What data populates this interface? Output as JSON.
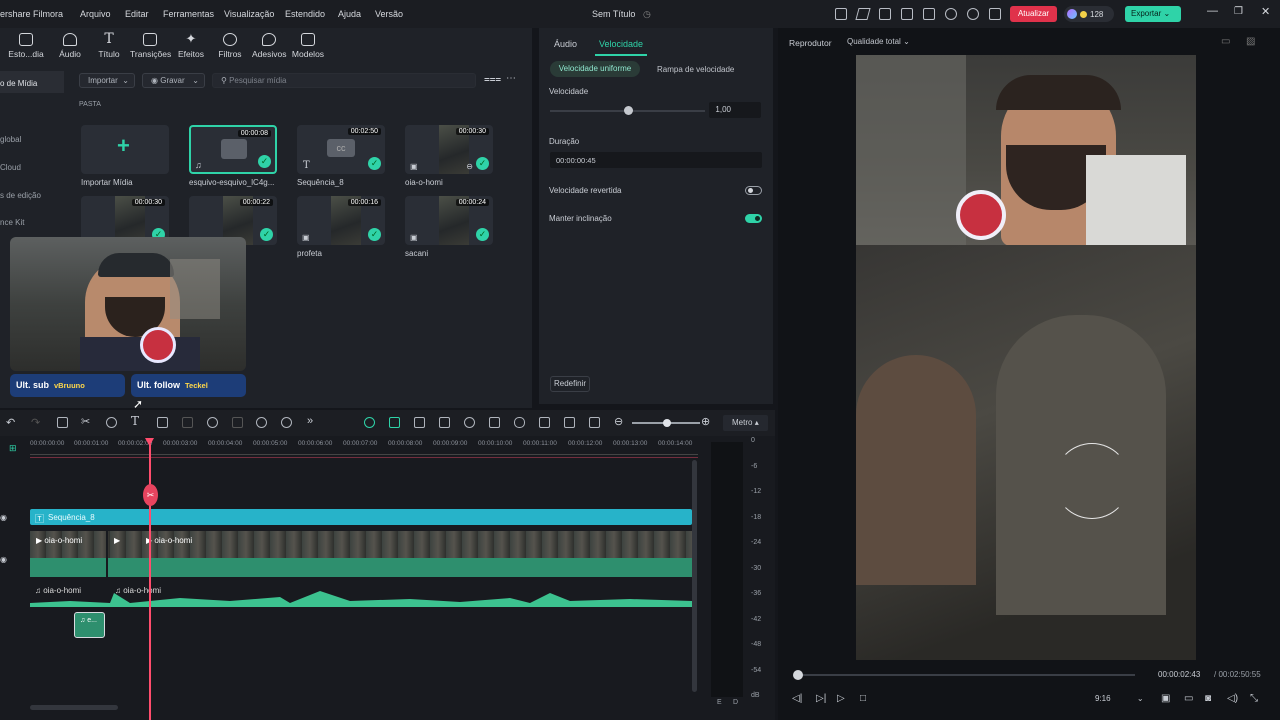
{
  "app": {
    "title_fragment": "ershare Filmora",
    "doc_title": "Sem Título"
  },
  "menu": [
    "Arquivo",
    "Editar",
    "Ferramentas",
    "Visualização",
    "Estendido",
    "Ajuda",
    "Versão"
  ],
  "top_buttons": {
    "update": "Atualizar",
    "credits": "128",
    "export": "Exportar"
  },
  "toolbar": [
    "Esto...dia",
    "Áudio",
    "Título",
    "Transições",
    "Efeitos",
    "Filtros",
    "Adesivos",
    "Modelos"
  ],
  "sidebar": [
    "o de Mídia",
    "global",
    "Cloud",
    "s de edição",
    "nce Kit"
  ],
  "media_bar": {
    "import": "Importar",
    "record": "Gravar",
    "search_placeholder": "Pesquisar mídia",
    "folder": "PASTA"
  },
  "media": [
    {
      "label": "Importar Mídia",
      "duration": ""
    },
    {
      "label": "esquivo-esquivo_lC4g...",
      "duration": "00:00:08"
    },
    {
      "label": "Sequência_8",
      "duration": "00:02:50"
    },
    {
      "label": "oia-o-homi",
      "duration": "00:00:30"
    },
    {
      "label": "",
      "duration": "00:00:30"
    },
    {
      "label": "",
      "duration": "00:00:22"
    },
    {
      "label": "profeta",
      "duration": "00:00:16"
    },
    {
      "label": "sacani",
      "duration": "00:00:24"
    }
  ],
  "overlay": {
    "sub_label": "Ult. sub",
    "sub_name": "vBruuno",
    "follow_label": "Ult. follow",
    "follow_name": "Teckel"
  },
  "props": {
    "tabs": [
      "Áudio",
      "Velocidade"
    ],
    "subtabs": [
      "Velocidade uniforme",
      "Rampa de velocidade"
    ],
    "speed_label": "Velocidade",
    "speed_value": "1,00",
    "duration_label": "Duração",
    "duration_value": "00:00:00:45",
    "reverse_label": "Velocidade revertida",
    "reverse_on": false,
    "keep_pitch_label": "Manter inclinação",
    "keep_pitch_on": true,
    "reset": "Redefinir",
    "speed_level": 0.5
  },
  "player": {
    "label": "Reprodutor",
    "quality": "Qualidade total",
    "time_current": "00:00:02:43",
    "time_total": "/ 00:02:50:55",
    "ratio": "9:16"
  },
  "timeline": {
    "meter_label": "Metro",
    "ruler": [
      "00:00:00:00",
      "00:00:01:00",
      "00:00:02:00",
      "00:00:03:00",
      "00:00:04:00",
      "00:00:05:00",
      "00:00:06:00",
      "00:00:07:00",
      "00:00:08:00",
      "00:00:09:00",
      "00:00:10:00",
      "00:00:11:00",
      "00:00:12:00",
      "00:00:13:00",
      "00:00:14:00"
    ],
    "title_clip": "Sequência_8",
    "video_clip_a": "oia-o-homi",
    "video_clip_b": "oia-o-homi",
    "audio_clip_a": "oia-o-homi",
    "audio_clip_b": "oia-o-homi",
    "small_clip": "e...",
    "meter_scale": [
      "0",
      "-6",
      "-12",
      "-18",
      "-24",
      "-30",
      "-36",
      "-42",
      "-48",
      "-54",
      "dB"
    ],
    "meter_channels": [
      "E",
      "D"
    ]
  },
  "colors": {
    "accent": "#2fd3a8",
    "update": "#e0324b",
    "title_track": "#27b3c9",
    "audio_track": "#3cc28f",
    "playhead": "#ff4d6d"
  }
}
